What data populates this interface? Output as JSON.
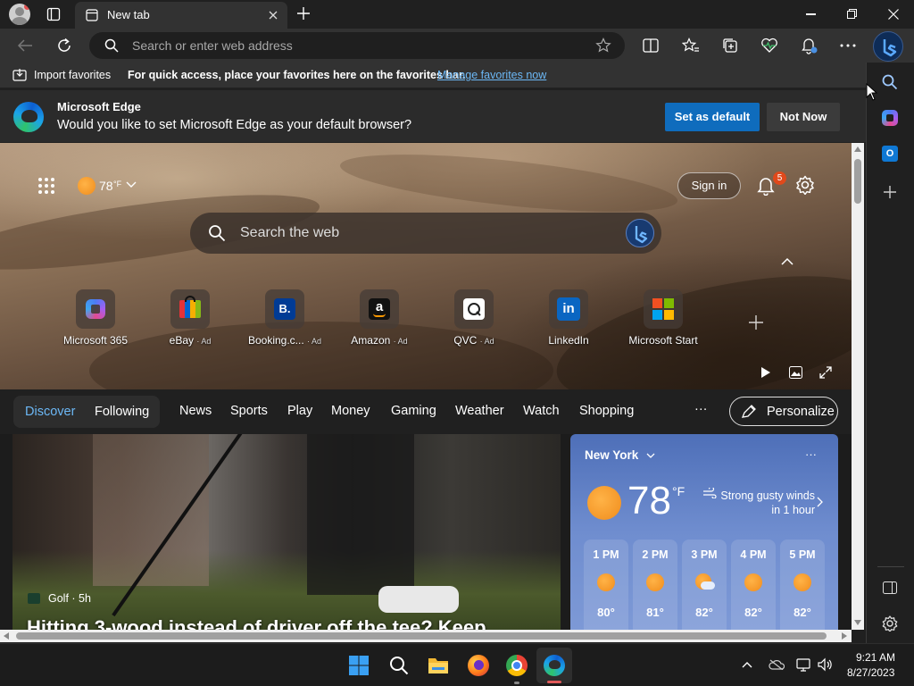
{
  "browser": {
    "tab_title": "New tab",
    "address_placeholder": "Search or enter web address"
  },
  "favorites_bar": {
    "import_label": "Import favorites",
    "message": "For quick access, place your favorites here on the favorites bar.",
    "manage_link": "Manage favorites now"
  },
  "infobar": {
    "title": "Microsoft Edge",
    "message": "Would you like to set Microsoft Edge as your default browser?",
    "set_default": "Set as default",
    "not_now": "Not Now"
  },
  "newtab": {
    "weather_temp": "78",
    "weather_unit": "°F",
    "sign_in": "Sign in",
    "notification_count": "5",
    "search_placeholder": "Search the web",
    "quick_links": [
      {
        "label": "Microsoft 365",
        "ad": ""
      },
      {
        "label": "eBay",
        "ad": "· Ad"
      },
      {
        "label": "Booking.c...",
        "ad": "· Ad"
      },
      {
        "label": "Amazon",
        "ad": "· Ad"
      },
      {
        "label": "QVC",
        "ad": "· Ad"
      },
      {
        "label": "LinkedIn",
        "ad": ""
      },
      {
        "label": "Microsoft Start",
        "ad": ""
      }
    ]
  },
  "nav": {
    "discover": "Discover",
    "following": "Following",
    "items": [
      "News",
      "Sports",
      "Play",
      "Money",
      "Gaming",
      "Weather",
      "Watch",
      "Shopping"
    ],
    "more": "···",
    "personalize": "Personalize"
  },
  "article": {
    "source": "Golf · 5h",
    "headline": "Hitting 3-wood instead of driver off the tee? Keep"
  },
  "weather_card": {
    "city": "New York",
    "temp": "78",
    "unit": "°F",
    "alert": "Strong gusty winds in 1 hour",
    "more": "···",
    "hourly": [
      {
        "hour": "1 PM",
        "temp": "80°",
        "icon": "sun"
      },
      {
        "hour": "2 PM",
        "temp": "81°",
        "icon": "sun"
      },
      {
        "hour": "3 PM",
        "temp": "82°",
        "icon": "partly-cloudy"
      },
      {
        "hour": "4 PM",
        "temp": "82°",
        "icon": "sun"
      },
      {
        "hour": "5 PM",
        "temp": "82°",
        "icon": "sun"
      }
    ]
  },
  "taskbar": {
    "time": "9:21 AM",
    "date": "8/27/2023"
  },
  "colors": {
    "accent": "#0f6cbd",
    "link": "#6cb8f6",
    "badge": "#e0491b"
  }
}
